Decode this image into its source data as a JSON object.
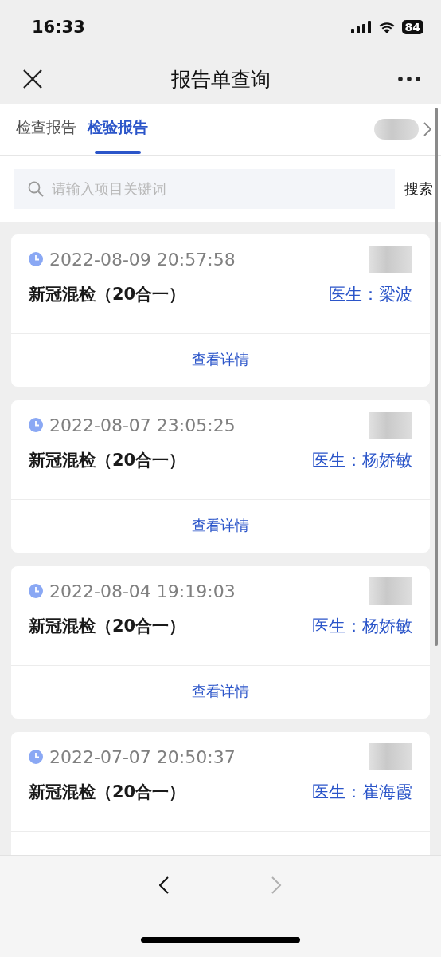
{
  "status_bar": {
    "time": "16:33",
    "battery": "84"
  },
  "nav_bar": {
    "title": "报告单查询"
  },
  "tabs": [
    {
      "label": "检查报告",
      "selected": false
    },
    {
      "label": "检验报告",
      "selected": true
    }
  ],
  "search": {
    "placeholder": "请输入项目关键词",
    "button": "搜索"
  },
  "reports": [
    {
      "time": "2022-08-09 20:57:58",
      "name": "新冠混检（20合一）",
      "doctor": "医生：梁波",
      "details": "查看详情"
    },
    {
      "time": "2022-08-07 23:05:25",
      "name": "新冠混检（20合一）",
      "doctor": "医生：杨娇敏",
      "details": "查看详情"
    },
    {
      "time": "2022-08-04 19:19:03",
      "name": "新冠混检（20合一）",
      "doctor": "医生：杨娇敏",
      "details": "查看详情"
    },
    {
      "time": "2022-07-07 20:50:37",
      "name": "新冠混检（20合一）",
      "doctor": "医生：崔海霞"
    }
  ],
  "browser_nav": [
    {
      "kind": "back",
      "disabled": false
    },
    {
      "kind": "forward",
      "disabled": true
    }
  ]
}
